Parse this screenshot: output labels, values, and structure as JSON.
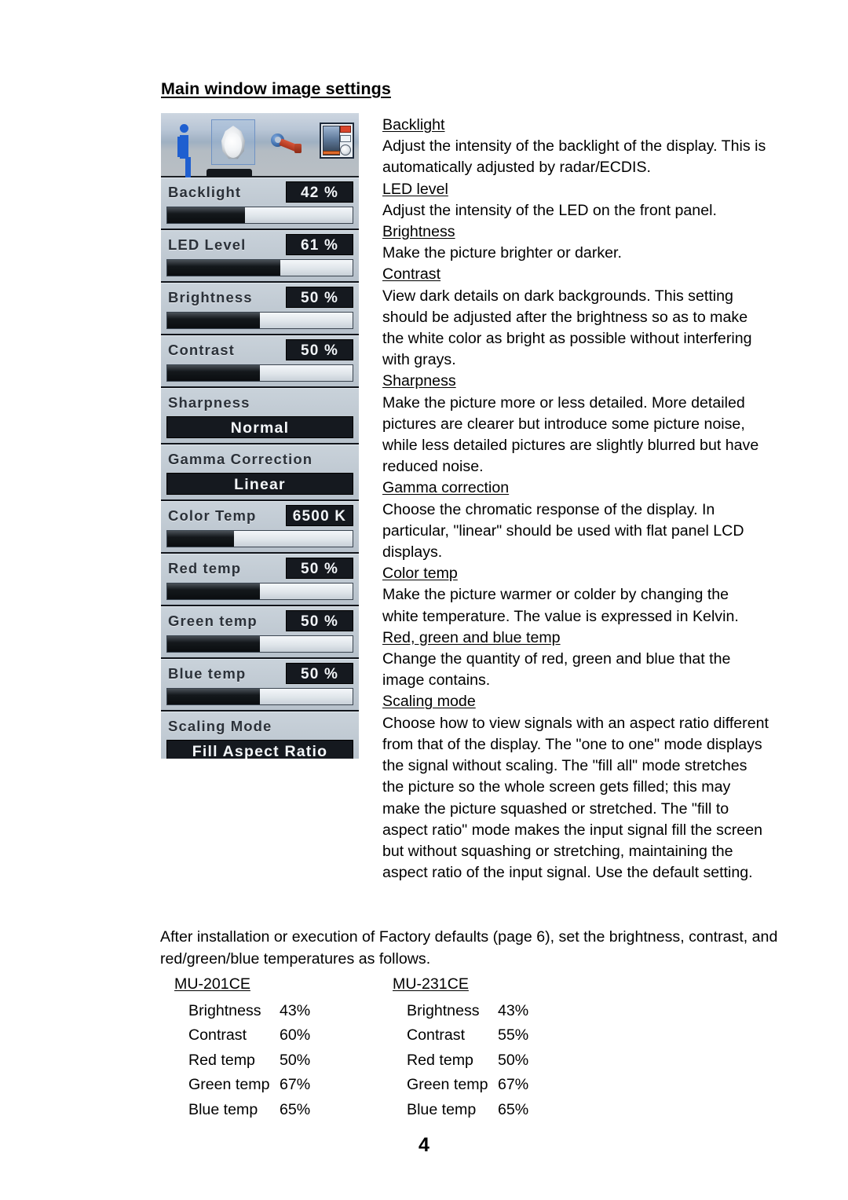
{
  "heading": "Main window image settings",
  "osd": {
    "toolbar": {
      "icons": [
        {
          "name": "info-icon",
          "label": "Information"
        },
        {
          "name": "brightness-bulb-icon",
          "label": "Image settings",
          "selected": true
        },
        {
          "name": "wrench-icon",
          "label": "Installation"
        },
        {
          "name": "window-layout-icon",
          "label": "Window layout"
        }
      ]
    },
    "rows": [
      {
        "label": "Backlight",
        "value": "42 %",
        "type": "slider",
        "fill_pct": 42
      },
      {
        "label": "LED Level",
        "value": "61 %",
        "type": "slider",
        "fill_pct": 61
      },
      {
        "label": "Brightness",
        "value": "50 %",
        "type": "slider",
        "fill_pct": 50
      },
      {
        "label": "Contrast",
        "value": "50 %",
        "type": "slider",
        "fill_pct": 50
      },
      {
        "label": "Sharpness",
        "value": "Normal",
        "type": "choice"
      },
      {
        "label": "Gamma Correction",
        "value": "Linear",
        "type": "choice"
      },
      {
        "label": "Color Temp",
        "value": "6500 K",
        "type": "slider",
        "fill_pct": 36
      },
      {
        "label": "Red temp",
        "value": "50 %",
        "type": "slider",
        "fill_pct": 50
      },
      {
        "label": "Green temp",
        "value": "50 %",
        "type": "slider",
        "fill_pct": 50
      },
      {
        "label": "Blue temp",
        "value": "50 %",
        "type": "slider",
        "fill_pct": 50
      },
      {
        "label": "Scaling Mode",
        "value": "Fill Aspect Ratio",
        "type": "choice"
      }
    ]
  },
  "descriptions": {
    "backlight_term": "Backlight",
    "backlight_text": "Adjust the intensity of the backlight of the display. This is automatically adjusted by radar/ECDIS.",
    "led_term": "LED level",
    "led_text": "Adjust the intensity of the LED on the front panel.",
    "brightness_term": "Brightness",
    "brightness_text": "Make the picture brighter or darker.",
    "contrast_term": "Contrast",
    "contrast_text": "View dark details on dark backgrounds. This setting should be adjusted after the brightness so as to make the white color as bright as possible without interfering with grays.",
    "sharpness_term": "Sharpness",
    "sharpness_text": "Make the picture more or less detailed. More detailed pictures are clearer but introduce some picture noise, while less detailed pictures are slightly blurred but have reduced noise.",
    "gamma_term": "Gamma correction",
    "gamma_text": "Choose the chromatic response of the display. In particular, \"linear\" should be used with flat panel LCD displays.",
    "colortemp_term": "Color temp",
    "colortemp_text": "Make the picture warmer or colder by changing the white temperature. The value is expressed in Kelvin.",
    "rgb_term": "Red, green and blue temp",
    "rgb_text": "Change the quantity of red, green and blue that the image contains.",
    "scaling_term": "Scaling mode",
    "scaling_text": "Choose how to view signals with an aspect ratio different from that of the display. The \"one to one\" mode displays the signal without scaling. The \"fill all\" mode stretches the picture so the whole screen gets filled; this may make the picture squashed or stretched. The \"fill to aspect ratio\" mode makes the input signal fill the screen but without squashing or stretching, maintaining the aspect ratio of the input signal. Use the default setting."
  },
  "closing_text": "After installation or execution of Factory defaults (page 6), set the brightness, contrast, and red/green/blue temperatures as follows.",
  "tables": [
    {
      "model": "MU-201CE",
      "rows": [
        {
          "name": "Brightness",
          "value": "43%"
        },
        {
          "name": "Contrast",
          "value": "60%"
        },
        {
          "name": "Red temp",
          "value": "50%"
        },
        {
          "name": "Green temp",
          "value": "67%"
        },
        {
          "name": "Blue temp",
          "value": "65%"
        }
      ]
    },
    {
      "model": "MU-231CE",
      "rows": [
        {
          "name": "Brightness",
          "value": "43%"
        },
        {
          "name": "Contrast",
          "value": "55%"
        },
        {
          "name": "Red temp",
          "value": "50%"
        },
        {
          "name": "Green temp",
          "value": "67%"
        },
        {
          "name": "Blue temp",
          "value": "65%"
        }
      ]
    }
  ],
  "page_number": "4"
}
